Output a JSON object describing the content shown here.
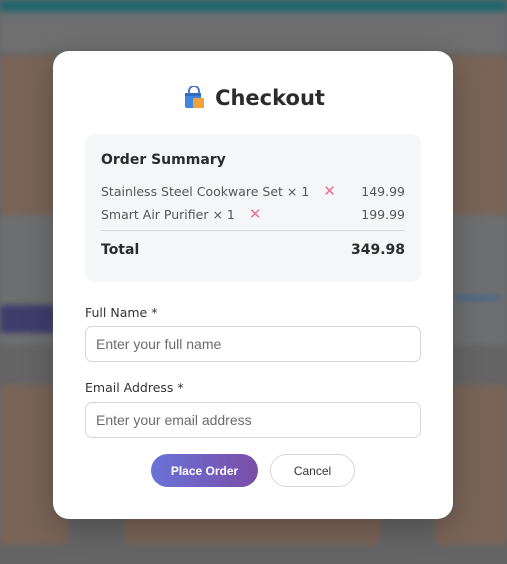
{
  "modal": {
    "icon": "shopping-bag-icon",
    "title": "Checkout"
  },
  "summary": {
    "heading": "Order Summary",
    "items": [
      {
        "name": "Stainless Steel Cookware Set × 1",
        "price": "149.99",
        "remove_icon": "close-icon"
      },
      {
        "name": "Smart Air Purifier × 1",
        "price": "199.99",
        "remove_icon": "close-icon"
      }
    ],
    "total_label": "Total",
    "total_value": "349.98"
  },
  "form": {
    "name_label": "Full Name *",
    "name_placeholder": "Enter your full name",
    "name_value": "",
    "email_label": "Email Address *",
    "email_placeholder": "Enter your email address",
    "email_value": ""
  },
  "actions": {
    "place_order": "Place Order",
    "cancel": "Cancel"
  },
  "colors": {
    "accent_gradient_start": "#6a72d8",
    "accent_gradient_end": "#7a4ea6",
    "remove": "#e8718f"
  }
}
